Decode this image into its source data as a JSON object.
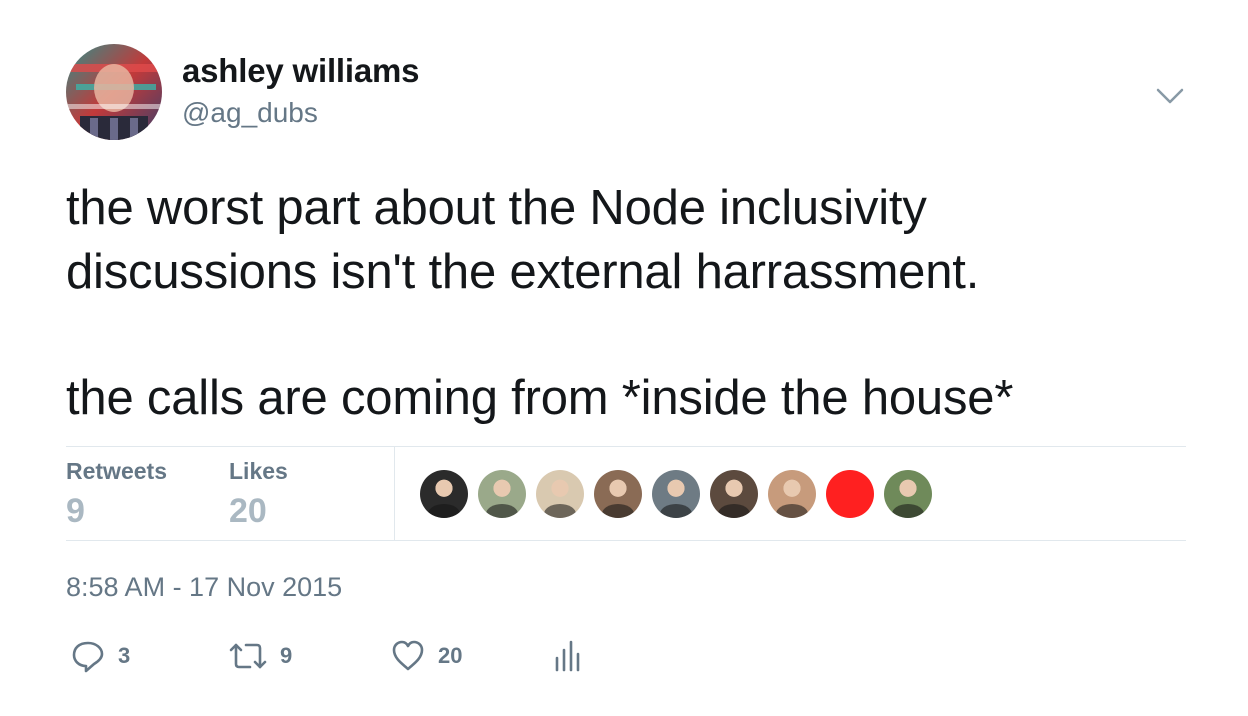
{
  "author": {
    "display_name": "ashley williams",
    "handle": "@ag_dubs",
    "avatar_icon": "user-avatar-photo"
  },
  "tweet": {
    "lines": [
      "the worst part about the Node inclusivity",
      "discussions isn't the external harrassment.",
      "the calls are coming from *inside the house*"
    ],
    "timestamp": "8:58 AM - 17 Nov 2015"
  },
  "stats": {
    "retweets_label": "Retweets",
    "retweets_value": "9",
    "likes_label": "Likes",
    "likes_value": "20"
  },
  "likers": [
    {
      "icon": "liker-avatar-1",
      "color": "#2b2b2b"
    },
    {
      "icon": "liker-avatar-2",
      "color": "#9aa98a"
    },
    {
      "icon": "liker-avatar-3",
      "color": "#d9c9b0"
    },
    {
      "icon": "liker-avatar-4",
      "color": "#8a6b55"
    },
    {
      "icon": "liker-avatar-5",
      "color": "#6e7b84"
    },
    {
      "icon": "liker-avatar-6",
      "color": "#5c4a3e"
    },
    {
      "icon": "liker-avatar-7",
      "color": "#c79b7c"
    },
    {
      "icon": "liker-avatar-8",
      "color": "#ff2020"
    },
    {
      "icon": "liker-avatar-9",
      "color": "#6f8a5a"
    }
  ],
  "actions": {
    "reply_count": "3",
    "retweet_count": "9",
    "like_count": "20"
  },
  "colors": {
    "text": "#14171a",
    "secondary": "#657786",
    "muted": "#aab8c2",
    "divider": "#e1e8ed"
  }
}
